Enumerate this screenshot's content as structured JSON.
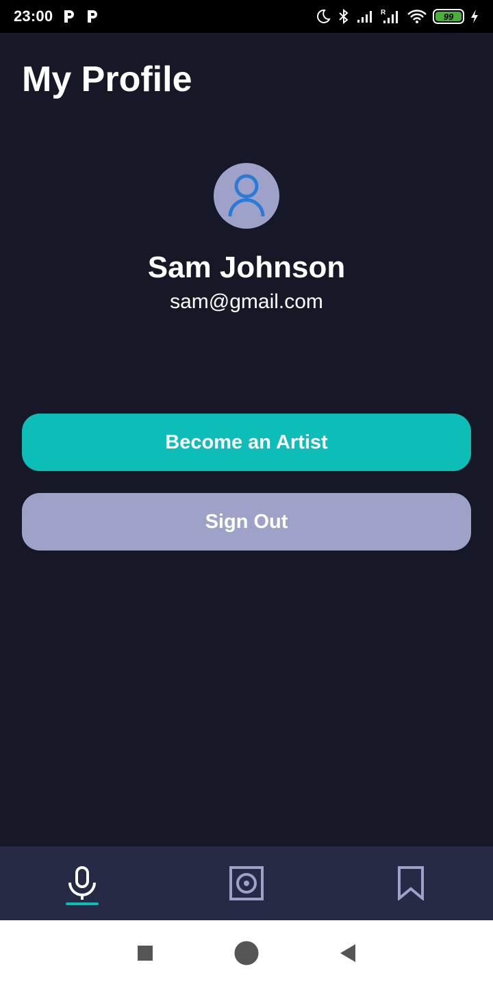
{
  "status_bar": {
    "time": "23:00",
    "left_icons": [
      "p-app-icon",
      "p-app-icon"
    ],
    "right_icons": [
      "moon-icon",
      "bluetooth-icon",
      "signal-icon",
      "signal-roaming-icon",
      "wifi-icon",
      "battery-icon",
      "charging-icon"
    ],
    "battery_level": "99"
  },
  "header": {
    "title": "My Profile"
  },
  "profile": {
    "avatar_icon": "user-icon",
    "name": "Sam Johnson",
    "email": "sam@gmail.com"
  },
  "actions": {
    "become_artist_label": "Become an Artist",
    "sign_out_label": "Sign Out"
  },
  "bottom_nav": {
    "items": [
      {
        "icon": "microphone-icon",
        "active": true
      },
      {
        "icon": "speaker-icon",
        "active": false
      },
      {
        "icon": "bookmark-icon",
        "active": false
      }
    ]
  },
  "system_nav": {
    "items": [
      "recents-square-icon",
      "home-circle-icon",
      "back-triangle-icon"
    ]
  },
  "colors": {
    "background": "#161827",
    "accent": "#0dbdb8",
    "secondary": "#9ea2c9",
    "nav_bar": "#272a45",
    "avatar_icon": "#2b7bd6"
  }
}
